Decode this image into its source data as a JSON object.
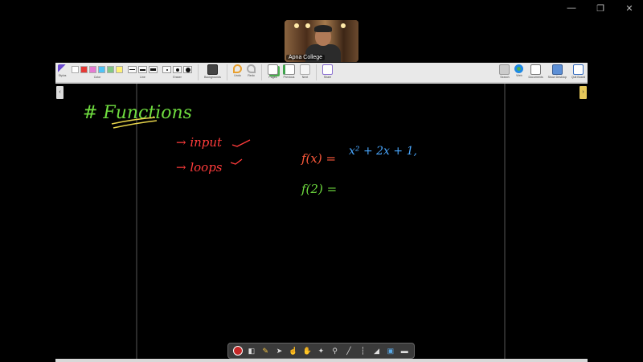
{
  "window_controls": {
    "minimize": "—",
    "restore": "❐",
    "close": "✕"
  },
  "webcam": {
    "name": "Apna College"
  },
  "toolbar": {
    "stylus_label": "Stylus",
    "color_label": "Color",
    "line_label": "Line",
    "eraser_label": "Eraser",
    "backgrounds_label": "Backgrounds",
    "undo_label": "Undo",
    "redo_label": "Redo",
    "pages_label": "Pages",
    "previous_label": "Previous",
    "next_label": "Next",
    "share_label": "Share",
    "search_label": "Search",
    "web_label": "Web",
    "documents_label": "Documents",
    "show_desktop_label": "Show Desktop",
    "quit_board_label": "Quit Board",
    "colors": [
      "#ffffff",
      "#e53935",
      "#e57ad2",
      "#4fc3f7",
      "#81c784",
      "#fff176"
    ]
  },
  "board": {
    "heading": "# Functions",
    "input_text": "→ input",
    "loops_text": "→ loops",
    "fx_lhs": "f(x) =",
    "fx_rhs": "x² + 2x + 1,",
    "f2_text": "f(2) =",
    "ink_colors": {
      "heading": "#6fdd3f",
      "notes": "#ff3b3b",
      "fx": "#ff5a3c",
      "expr": "#4aa8ff",
      "f2": "#6fdd3f"
    }
  }
}
